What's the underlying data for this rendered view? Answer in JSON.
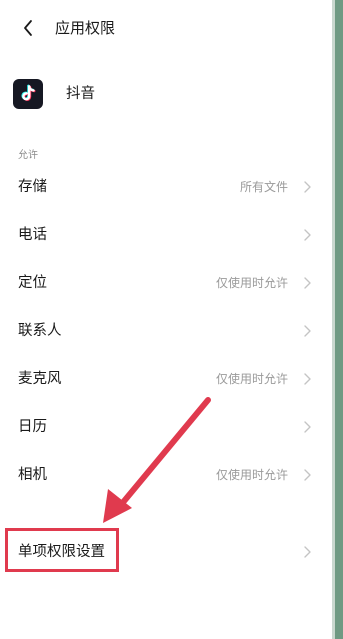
{
  "header": {
    "title": "应用权限"
  },
  "app": {
    "name": "抖音"
  },
  "section": {
    "label": "允许"
  },
  "permissions": [
    {
      "name": "存储",
      "status": "所有文件"
    },
    {
      "name": "电话",
      "status": ""
    },
    {
      "name": "定位",
      "status": "仅使用时允许"
    },
    {
      "name": "联系人",
      "status": ""
    },
    {
      "name": "麦克风",
      "status": "仅使用时允许"
    },
    {
      "name": "日历",
      "status": ""
    },
    {
      "name": "相机",
      "status": "仅使用时允许"
    }
  ],
  "single_permission": {
    "label": "单项权限设置"
  },
  "colors": {
    "annotation_red": "#e03a4e",
    "edge_green": "#6f9a83",
    "app_icon_bg": "#161823"
  },
  "icons": {
    "back": "chevron-left-icon",
    "app": "tiktok-logo-icon",
    "row_arrow": "chevron-right-icon"
  }
}
